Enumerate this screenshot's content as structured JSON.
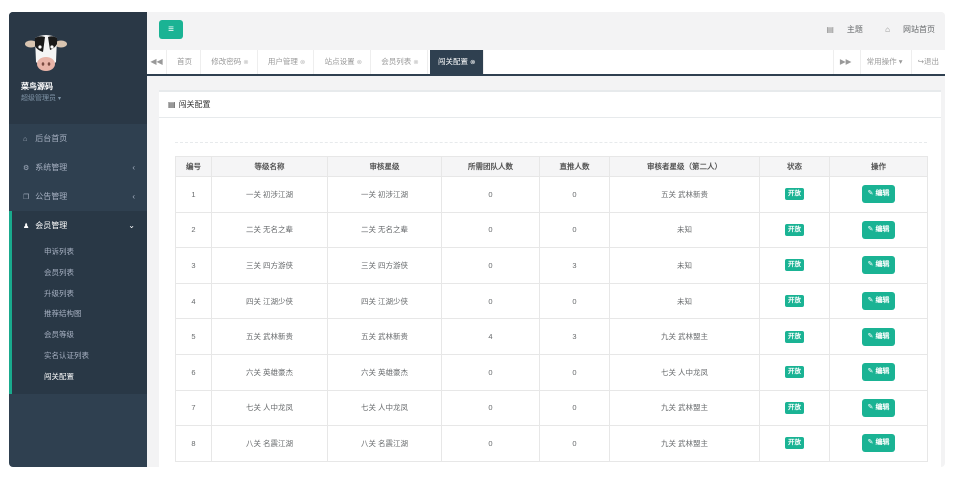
{
  "colors": {
    "accent": "#1ab394",
    "sidebar": "#2f4050",
    "active_tab": "#2f4050"
  },
  "profile": {
    "name": "菜鸟源码",
    "role": "超级管理员",
    "caret": "▾"
  },
  "nav": {
    "items": [
      {
        "icon": "home-icon",
        "glyph": "⌂",
        "label": "后台首页",
        "arrow": ""
      },
      {
        "icon": "gear-icon",
        "glyph": "⚙",
        "label": "系统管理",
        "arrow": "‹"
      },
      {
        "icon": "copy-icon",
        "glyph": "❐",
        "label": "公告管理",
        "arrow": "‹"
      },
      {
        "icon": "user-icon",
        "glyph": "♟",
        "label": "会员管理",
        "arrow": "⌄"
      }
    ],
    "submenu": [
      "申诉列表",
      "会员列表",
      "升级列表",
      "推荐结构图",
      "会员等级",
      "实名认证列表",
      "闯关配置"
    ]
  },
  "header": {
    "menu_icon": "≡",
    "theme_label": "主题",
    "site_home_label": "网站首页"
  },
  "tabs": {
    "items": [
      {
        "label": "首页",
        "closable": false
      },
      {
        "label": "修改密码",
        "closable": true
      },
      {
        "label": "用户管理",
        "closable": true
      },
      {
        "label": "站点设置",
        "closable": true
      },
      {
        "label": "会员列表",
        "closable": true
      },
      {
        "label": "闯关配置",
        "closable": true,
        "active": true
      }
    ],
    "common_ops": "常用操作",
    "return": "退出",
    "close_glyph": "⊗"
  },
  "panel": {
    "title": "闯关配置"
  },
  "table": {
    "headers": [
      "编号",
      "等级名称",
      "审核星级",
      "所需团队人数",
      "直推人数",
      "审核者星级（第二人）",
      "状态",
      "操作"
    ],
    "status_label": "开放",
    "edit_label": "编辑",
    "rows": [
      [
        "1",
        "一关 初涉江湖",
        "一关 初涉江湖",
        "0",
        "0",
        "五关 武林新贵"
      ],
      [
        "2",
        "二关 无名之辈",
        "二关 无名之辈",
        "0",
        "0",
        "未知"
      ],
      [
        "3",
        "三关 四方游侠",
        "三关 四方游侠",
        "0",
        "3",
        "未知"
      ],
      [
        "4",
        "四关 江湖少侠",
        "四关 江湖少侠",
        "0",
        "0",
        "未知"
      ],
      [
        "5",
        "五关 武林新贵",
        "五关 武林新贵",
        "4",
        "3",
        "九关 武林盟主"
      ],
      [
        "6",
        "六关 英雄豪杰",
        "六关 英雄豪杰",
        "0",
        "0",
        "七关 人中龙凤"
      ],
      [
        "7",
        "七关 人中龙凤",
        "七关 人中龙凤",
        "0",
        "0",
        "九关 武林盟主"
      ],
      [
        "8",
        "八关 名震江湖",
        "八关 名震江湖",
        "0",
        "0",
        "九关 武林盟主"
      ]
    ]
  }
}
